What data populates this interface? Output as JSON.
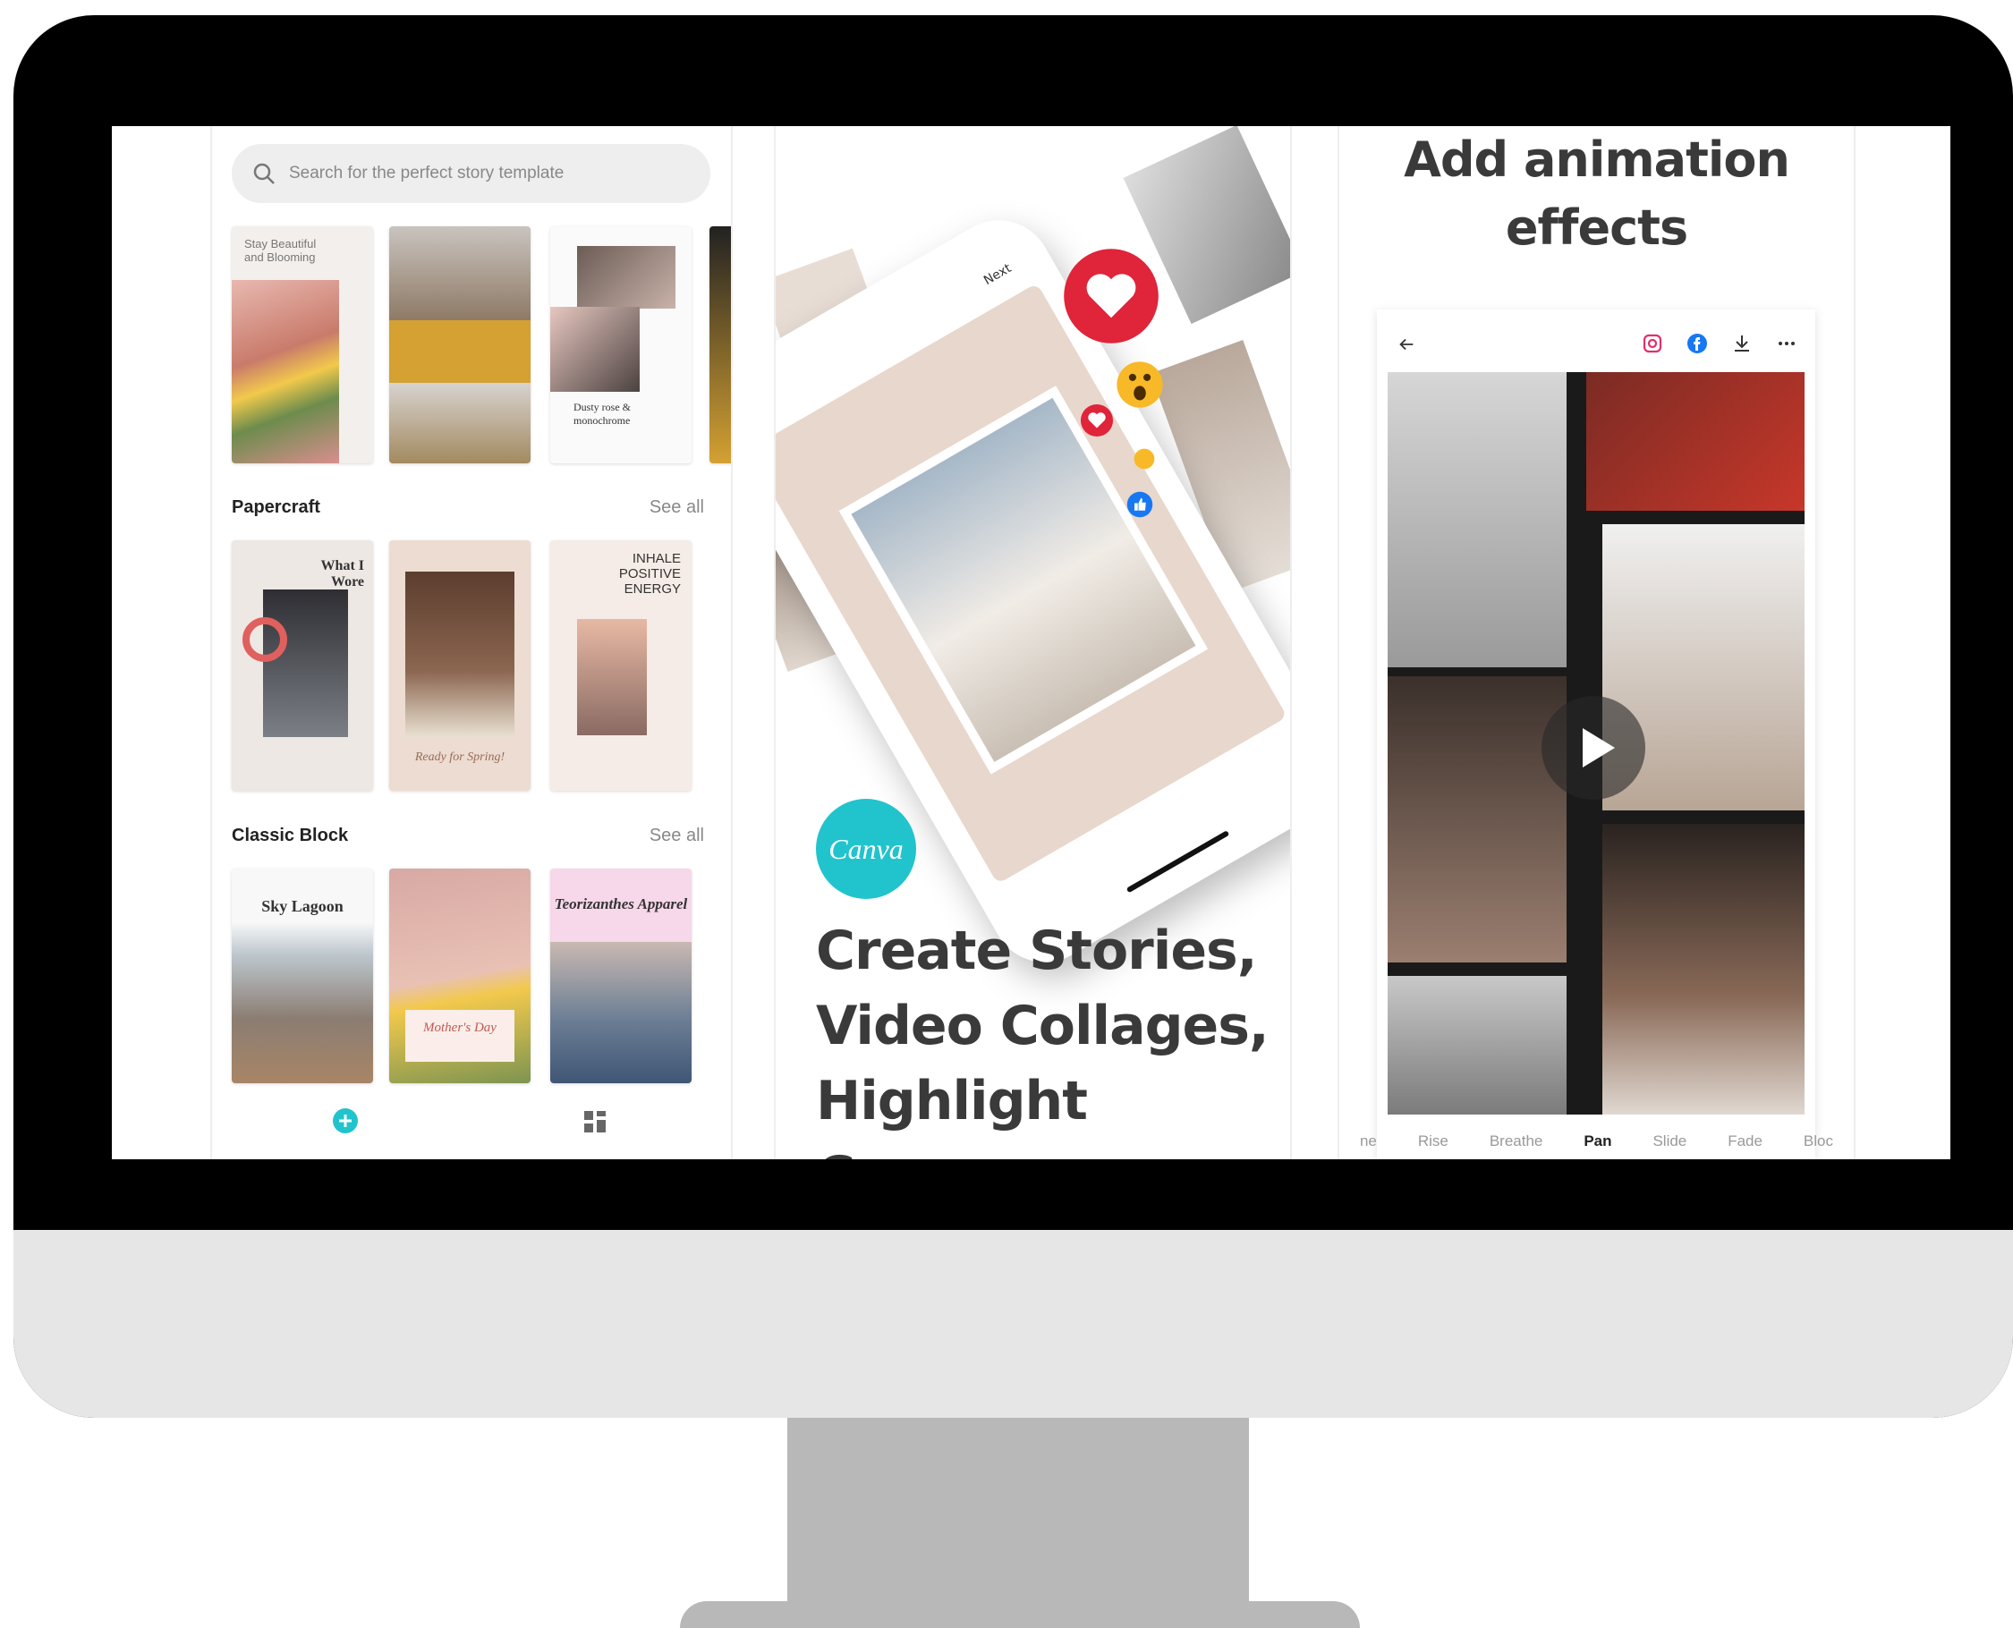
{
  "panel1": {
    "search_placeholder": "Search for the perfect story template",
    "template1_text": "Stay Beautiful and Blooming",
    "template3_text": "Dusty rose & monochrome",
    "sections": [
      {
        "title": "Papercraft",
        "see_all": "See all"
      },
      {
        "title": "Classic Block",
        "see_all": "See all"
      }
    ],
    "papercraft_t1": "What I Wore",
    "papercraft_t2": "Ready for Spring!",
    "papercraft_t3": "INHALE POSITIVE ENERGY",
    "classic_t1": "Sky Lagoon",
    "classic_t2": "Mother's Day",
    "classic_t3": "Teorizanthes Apparel"
  },
  "panel2": {
    "logo": "Canva",
    "headline_line1": "Create Stories,",
    "headline_line2": "Video Collages,",
    "headline_line3": "Highlight Covers",
    "phone_next": "Next"
  },
  "panel3": {
    "title_line1": "Add animation",
    "title_line2": "effects",
    "effects": [
      "ne",
      "Rise",
      "Breathe",
      "Pan",
      "Slide",
      "Fade",
      "Bloc"
    ],
    "active_effect": "Pan"
  },
  "colors": {
    "canva_teal": "#21c4cc",
    "heart_red": "#e0243a",
    "mustard": "#d4a132",
    "bezel": "#000000",
    "chin": "#e6e6e6",
    "stand": "#b8b8b8"
  }
}
